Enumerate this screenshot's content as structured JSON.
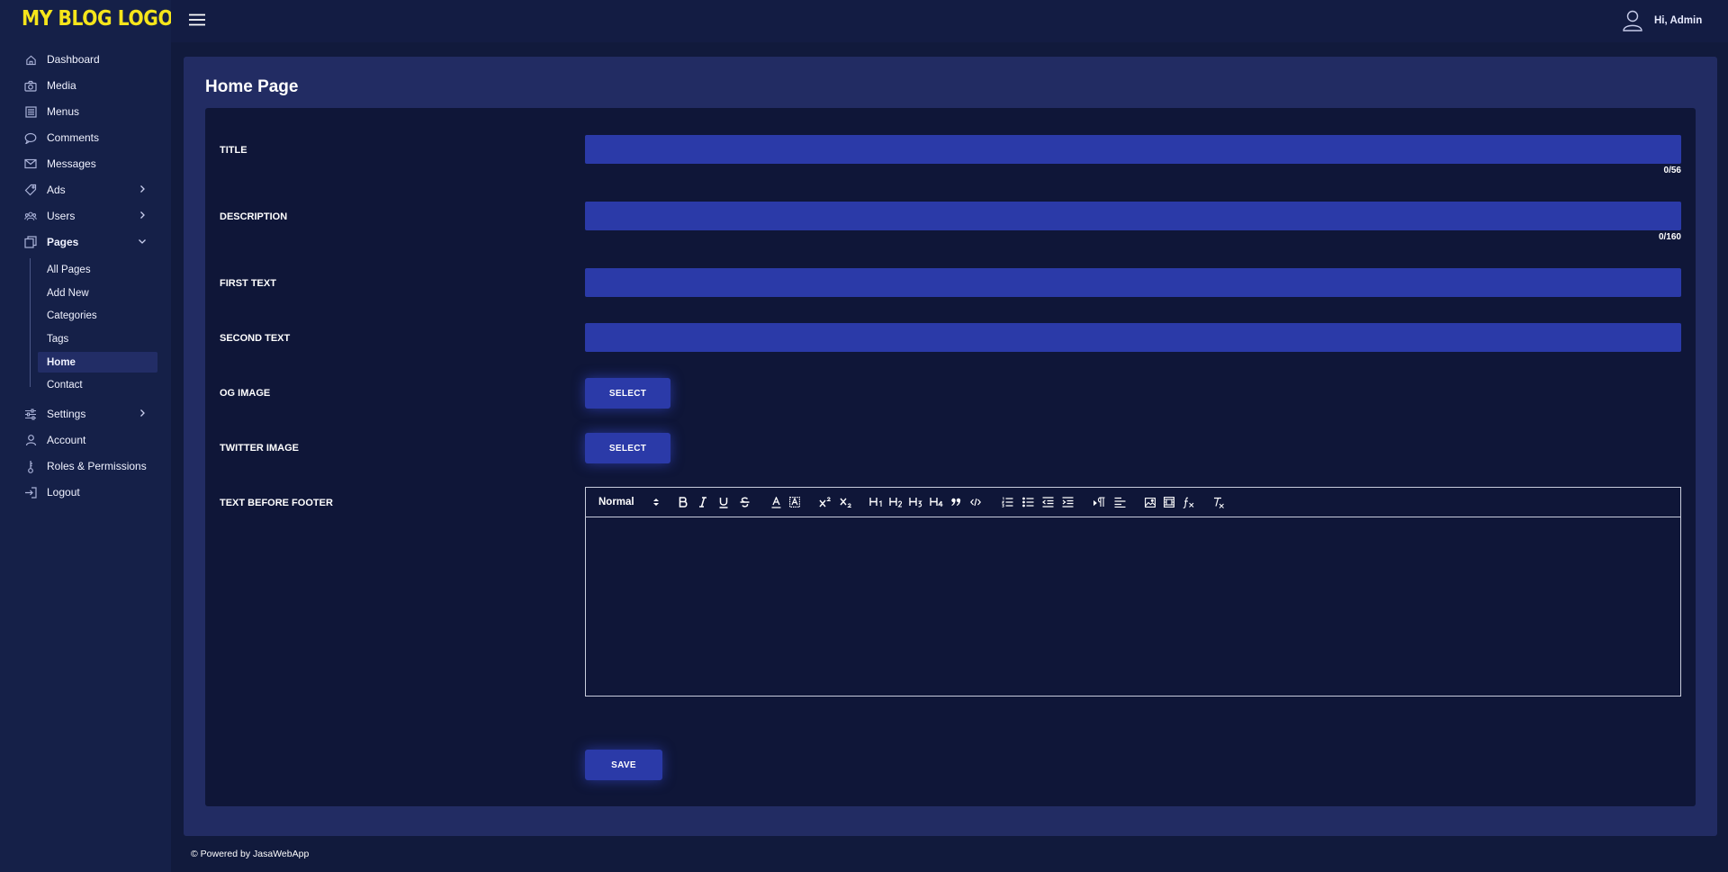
{
  "brand": {
    "logo_text": "MY BLOG LOGO",
    "logo_color": "#f5e51b"
  },
  "header": {
    "greeting": "Hi, Admin"
  },
  "sidebar": {
    "items": [
      {
        "label": "Dashboard",
        "icon": "home-icon"
      },
      {
        "label": "Media",
        "icon": "camera-icon"
      },
      {
        "label": "Menus",
        "icon": "list-icon"
      },
      {
        "label": "Comments",
        "icon": "comment-icon"
      },
      {
        "label": "Messages",
        "icon": "envelope-icon"
      },
      {
        "label": "Ads",
        "icon": "tag-icon",
        "chevron": "right"
      },
      {
        "label": "Users",
        "icon": "users-icon",
        "chevron": "right"
      },
      {
        "label": "Pages",
        "icon": "pages-icon",
        "chevron": "down"
      },
      {
        "label": "Settings",
        "icon": "sliders-icon",
        "chevron": "right"
      },
      {
        "label": "Account",
        "icon": "user-icon"
      },
      {
        "label": "Roles & Permissions",
        "icon": "key-icon"
      },
      {
        "label": "Logout",
        "icon": "logout-icon"
      }
    ],
    "pages_submenu": [
      "All Pages",
      "Add New",
      "Categories",
      "Tags",
      "Home",
      "Contact"
    ],
    "active_submenu": "Home"
  },
  "main": {
    "title": "Home Page",
    "fields": {
      "title": {
        "label": "TITLE",
        "value": "",
        "counter": "0/56"
      },
      "description": {
        "label": "DESCRIPTION",
        "value": "",
        "counter": "0/160"
      },
      "first_text": {
        "label": "FIRST TEXT",
        "value": ""
      },
      "second_text": {
        "label": "SECOND TEXT",
        "value": ""
      },
      "og_image": {
        "label": "OG IMAGE",
        "button": "SELECT"
      },
      "twitter_image": {
        "label": "TWITTER IMAGE",
        "button": "SELECT"
      },
      "text_before_footer": {
        "label": "TEXT BEFORE FOOTER",
        "format_select": "Normal",
        "body": ""
      }
    },
    "save_label": "SAVE"
  },
  "footer": {
    "text": "© Powered by JasaWebApp"
  },
  "colors": {
    "accent": "#2b3aa8",
    "background": "#111a3c",
    "card": "#0f1638",
    "sidebar": "#152048"
  }
}
